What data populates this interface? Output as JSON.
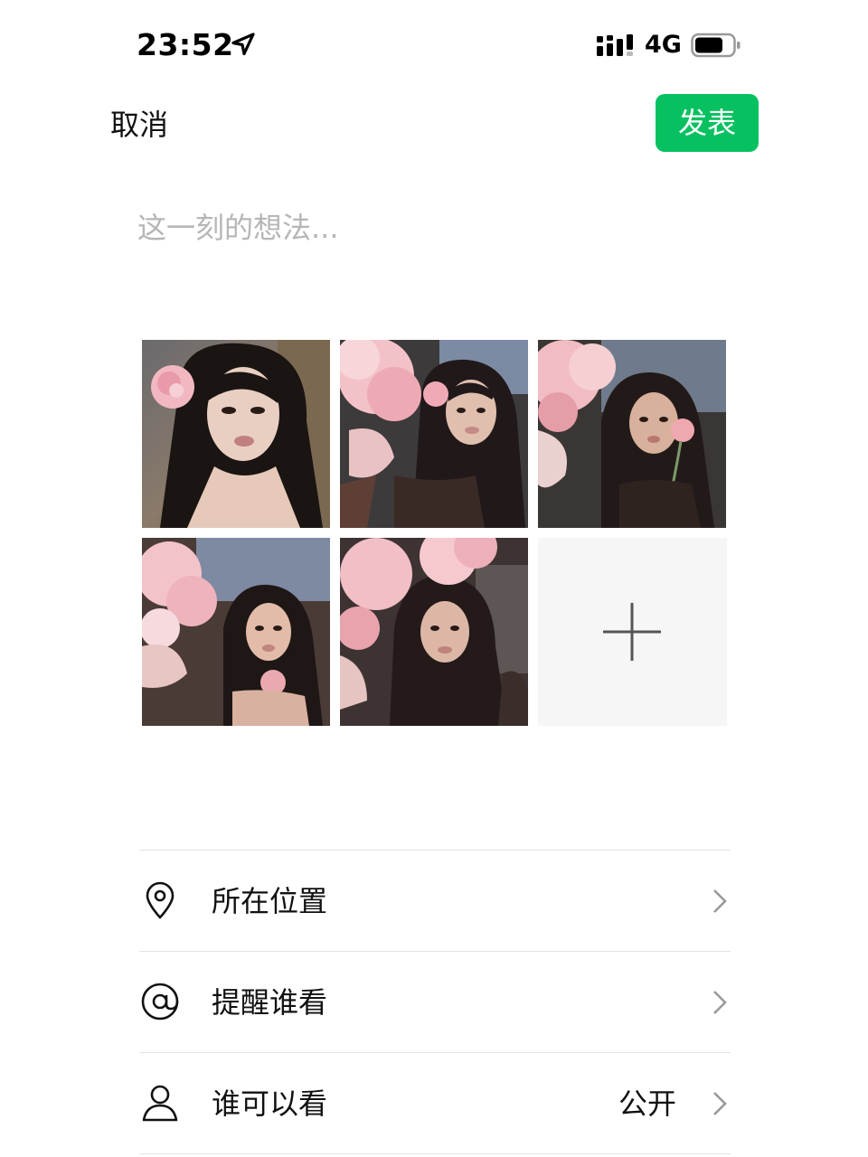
{
  "status_bar": {
    "time": "23:52",
    "network": "4G",
    "icons": [
      "location-arrow-icon",
      "signal-icon",
      "battery-icon"
    ]
  },
  "nav": {
    "cancel_label": "取消",
    "publish_label": "发表"
  },
  "composer": {
    "placeholder": "这一刻的想法...",
    "value": ""
  },
  "photos": {
    "count": 5,
    "add_icon": "plus-icon"
  },
  "options": [
    {
      "label": "所在位置",
      "icon": "location-pin-icon",
      "value": ""
    },
    {
      "label": "提醒谁看",
      "icon": "at-icon",
      "value": ""
    },
    {
      "label": "谁可以看",
      "icon": "person-icon",
      "value": "公开"
    }
  ],
  "colors": {
    "accent": "#07c160",
    "placeholder": "#b6b6b6",
    "divider": "#e4e4e4",
    "add_tile": "#f6f6f6"
  }
}
